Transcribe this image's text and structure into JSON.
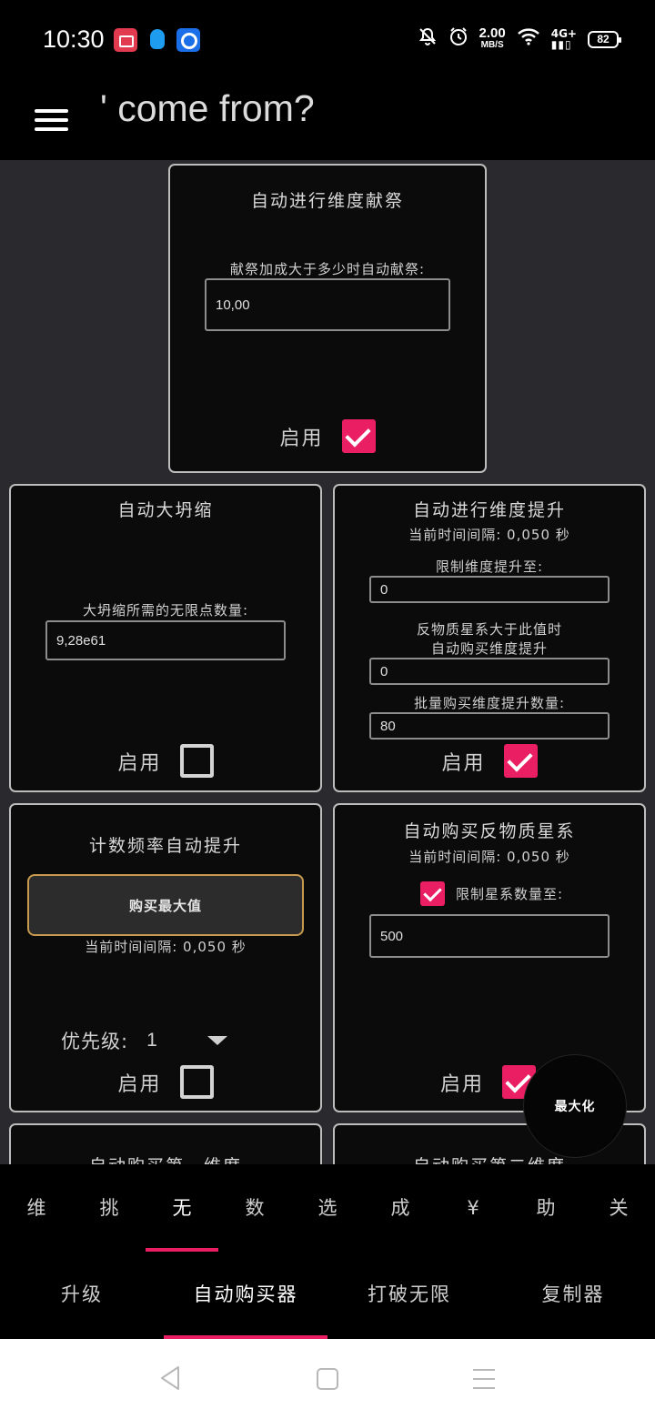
{
  "status_bar": {
    "time": "10:30",
    "apps": [
      "screen-recorder-icon",
      "qq-icon",
      "browser-icon"
    ],
    "system_icons": [
      "mute-bell-icon",
      "alarm-icon",
      "wifi-icon",
      "signal-icon"
    ],
    "network_speed": "2.00",
    "network_unit": "MB/S",
    "network_type": "4G+",
    "battery": "82"
  },
  "app_bar": {
    "title": "' come from?"
  },
  "cards": {
    "sacrifice": {
      "title": "自动进行维度献祭",
      "label": "献祭加成大于多少时自动献祭:",
      "value": "10,00",
      "enable_label": "启用",
      "enabled": true
    },
    "big_crunch": {
      "title": "自动大坍缩",
      "label": "大坍缩所需的无限点数量:",
      "value": "9,28e61",
      "enable_label": "启用",
      "enabled": false
    },
    "dim_boost": {
      "title": "自动进行维度提升",
      "interval": "当前时间间隔:  0,050 秒",
      "limit_label": "限制维度提升至:",
      "limit_value": "0",
      "galaxy_label_1": "反物质星系大于此值时",
      "galaxy_label_2": "自动购买维度提升",
      "galaxy_value": "0",
      "bulk_label": "批量购买维度提升数量:",
      "bulk_value": "80",
      "enable_label": "启用",
      "enabled": true
    },
    "tickspeed": {
      "title": "计数频率自动提升",
      "button": "购买最大值",
      "interval": "当前时间间隔:  0,050 秒",
      "priority_label": "优先级:",
      "priority_value": "1",
      "enable_label": "启用",
      "enabled": false
    },
    "galaxy": {
      "title": "自动购买反物质星系",
      "interval": "当前时间间隔:  0,050 秒",
      "limit_label": "限制星系数量至:",
      "limit_checked": true,
      "limit_value": "500",
      "enable_label": "启用",
      "enabled": true
    },
    "dim1": {
      "title": "自动购买第一维度"
    },
    "dim2": {
      "title": "自动购买第二维度"
    }
  },
  "fab": {
    "label": "最大化"
  },
  "main_tabs": [
    "维",
    "挑",
    "无",
    "数",
    "选",
    "成",
    "¥",
    "助",
    "关"
  ],
  "main_tab_active": 2,
  "sub_tabs": [
    "升级",
    "自动购买器",
    "打破无限",
    "复制器"
  ],
  "sub_tab_active": 1,
  "colors": {
    "accent": "#e91e63",
    "button_border": "#c79a4d",
    "card_bg": "#0b0b0b",
    "content_bg": "#2a2a2e"
  }
}
